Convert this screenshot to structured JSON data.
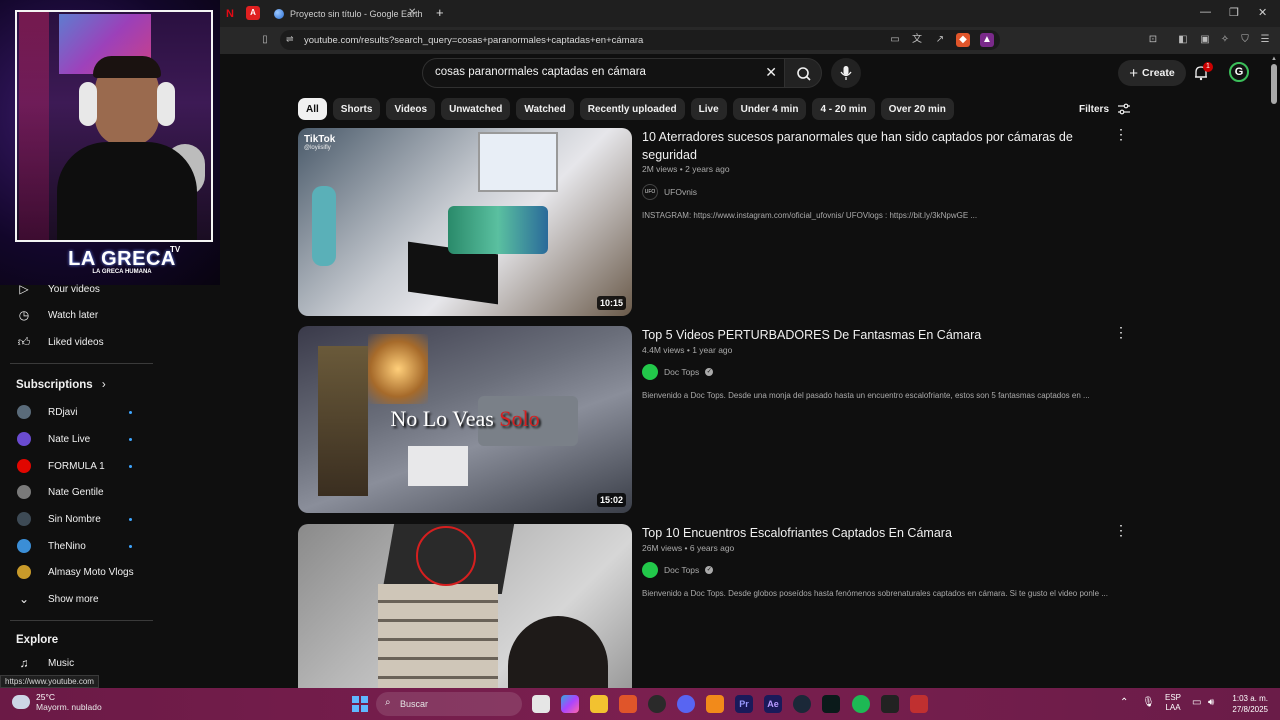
{
  "browser": {
    "tab_title": "Proyecto sin título - Google Earth",
    "new_tab_symbol": "+",
    "url": "youtube.com/results?search_query=cosas+paranormales+captadas+en+cámara",
    "status_url": "https://www.youtube.com"
  },
  "header": {
    "search_value": "cosas paranormales captadas en cámara",
    "create_label": "Create",
    "notif_count": "1",
    "avatar_letter": "G"
  },
  "chips": [
    "All",
    "Shorts",
    "Videos",
    "Unwatched",
    "Watched",
    "Recently uploaded",
    "Live",
    "Under 4 min",
    "4 - 20 min",
    "Over 20 min"
  ],
  "filters_label": "Filters",
  "overlay": {
    "logo_main": "LA GRECA",
    "logo_sub": "LA GRECA HUMANA",
    "logo_tv": "TV"
  },
  "sidebar": {
    "your_videos": "Your videos",
    "watch_later": "Watch later",
    "liked_videos": "Liked videos",
    "subscriptions_heading": "Subscriptions",
    "subscriptions": [
      {
        "name": "RDjavi",
        "color": "#5a6b7a"
      },
      {
        "name": "Nate Live",
        "color": "#6a4bd0"
      },
      {
        "name": "FORMULA 1",
        "color": "#e10600"
      },
      {
        "name": "Nate Gentile",
        "color": "#7a7a7a"
      },
      {
        "name": "Sin Nombre",
        "color": "#3d4a55"
      },
      {
        "name": "TheNino",
        "color": "#3b8ed6"
      },
      {
        "name": "Almasy Moto Vlogs",
        "color": "#c89a2a"
      }
    ],
    "show_more": "Show more",
    "explore_heading": "Explore",
    "music": "Music"
  },
  "videos": [
    {
      "title": "10 Aterradores sucesos paranormales que han sido captados por cámaras de seguridad",
      "meta": "2M views • 2 years ago",
      "channel": "UFOvnis",
      "channel_avatar": "UFO",
      "verified": false,
      "description": "INSTAGRAM: https://www.instagram.com/oficial_ufovnis/ UFOVlogs : https://bit.ly/3kNpwGE ...",
      "duration": "10:15",
      "thumb_label": "TikTok",
      "thumb_handle": "@loyiisifly",
      "thumb_overlay": ""
    },
    {
      "title": "Top 5 Videos PERTURBADORES De Fantasmas En Cámara",
      "meta": "4.4M views • 1 year ago",
      "channel": "Doc Tops",
      "channel_avatar": "",
      "verified": true,
      "description": "Bienvenido a Doc Tops. Desde una monja del pasado hasta un encuentro escalofriante, estos son 5 fantasmas captados en ...",
      "duration": "15:02",
      "thumb_label": "",
      "thumb_handle": "",
      "thumb_overlay": "No Lo Veas",
      "thumb_overlay_red": "Solo"
    },
    {
      "title": "Top 10 Encuentros Escalofriantes Captados En Cámara",
      "meta": "26M views • 6 years ago",
      "channel": "Doc Tops",
      "channel_avatar": "",
      "verified": true,
      "description": "Bienvenido a Doc Tops. Desde globos poseídos hasta fenómenos sobrenaturales captados en cámara. Si te gusto el video ponle ...",
      "duration": "",
      "thumb_label": "",
      "thumb_handle": "",
      "thumb_overlay": ""
    }
  ],
  "taskbar": {
    "weather_temp": "25°C",
    "weather_desc": "Mayorm. nublado",
    "search_placeholder": "Buscar",
    "lang_top": "ESP",
    "lang_bottom": "LAA",
    "time": "1:03 a. m.",
    "date": "27/8/2025"
  },
  "colors": {
    "bg": "#0f0f0f",
    "accent_blue": "#3ea6ff",
    "notif_red": "#cc0000",
    "taskbar": "#6b1a46"
  }
}
